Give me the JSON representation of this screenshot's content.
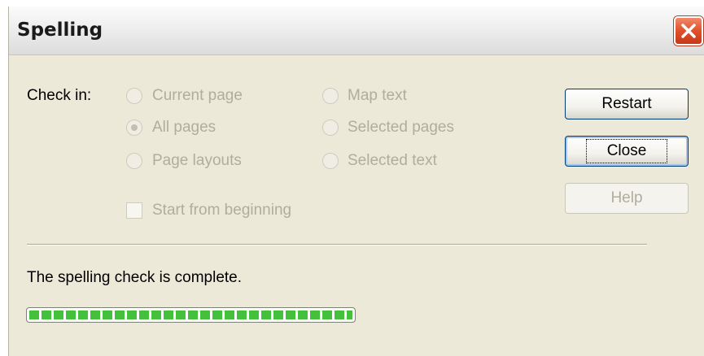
{
  "window": {
    "title": "Spelling",
    "close_icon": "close-icon"
  },
  "check_in": {
    "label": "Check in:",
    "options": [
      {
        "label": "Current page",
        "selected": false
      },
      {
        "label": "All pages",
        "selected": true
      },
      {
        "label": "Page layouts",
        "selected": false
      },
      {
        "label": "Map text",
        "selected": false
      },
      {
        "label": "Selected pages",
        "selected": false
      },
      {
        "label": "Selected text",
        "selected": false
      }
    ],
    "start_from_beginning": {
      "label": "Start from beginning",
      "checked": false
    }
  },
  "buttons": {
    "restart": "Restart",
    "close": "Close",
    "help": "Help"
  },
  "status": {
    "message": "The spelling check is complete.",
    "progress_fraction": 1.0
  },
  "colors": {
    "progress": "#44c03a",
    "close_button": "#e0502a"
  }
}
